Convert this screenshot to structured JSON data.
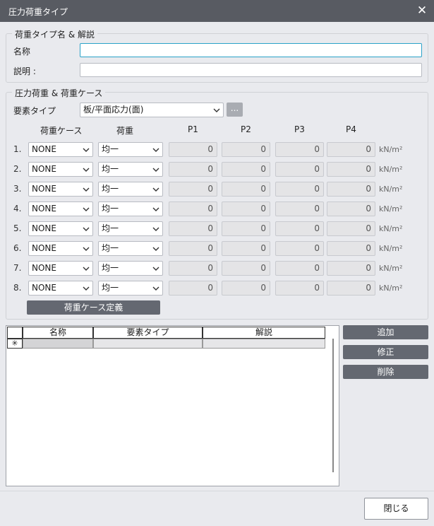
{
  "window": {
    "title": "圧力荷重タイプ",
    "close_glyph": "✕"
  },
  "name_group": {
    "legend": "荷重タイプ名 & 解説",
    "name_label": "名称",
    "name_value": "",
    "desc_label": "説明 :",
    "desc_value": ""
  },
  "load_group": {
    "legend": "圧力荷重 & 荷重ケース",
    "element_type_label": "要素タイプ",
    "element_type_value": "板/平面応力(面)",
    "browse_label": "...",
    "headers": {
      "case": "荷重ケース",
      "load": "荷重",
      "p1": "P1",
      "p2": "P2",
      "p3": "P3",
      "p4": "P4"
    },
    "rows": [
      {
        "num": "1.",
        "case": "NONE",
        "load": "均一",
        "p1": "0",
        "p2": "0",
        "p3": "0",
        "p4": "0",
        "unit": "kN/m²"
      },
      {
        "num": "2.",
        "case": "NONE",
        "load": "均一",
        "p1": "0",
        "p2": "0",
        "p3": "0",
        "p4": "0",
        "unit": "kN/m²"
      },
      {
        "num": "3.",
        "case": "NONE",
        "load": "均一",
        "p1": "0",
        "p2": "0",
        "p3": "0",
        "p4": "0",
        "unit": "kN/m²"
      },
      {
        "num": "4.",
        "case": "NONE",
        "load": "均一",
        "p1": "0",
        "p2": "0",
        "p3": "0",
        "p4": "0",
        "unit": "kN/m²"
      },
      {
        "num": "5.",
        "case": "NONE",
        "load": "均一",
        "p1": "0",
        "p2": "0",
        "p3": "0",
        "p4": "0",
        "unit": "kN/m²"
      },
      {
        "num": "6.",
        "case": "NONE",
        "load": "均一",
        "p1": "0",
        "p2": "0",
        "p3": "0",
        "p4": "0",
        "unit": "kN/m²"
      },
      {
        "num": "7.",
        "case": "NONE",
        "load": "均一",
        "p1": "0",
        "p2": "0",
        "p3": "0",
        "p4": "0",
        "unit": "kN/m²"
      },
      {
        "num": "8.",
        "case": "NONE",
        "load": "均一",
        "p1": "0",
        "p2": "0",
        "p3": "0",
        "p4": "0",
        "unit": "kN/m²"
      }
    ],
    "define_cases_label": "荷重ケース定義"
  },
  "grid": {
    "row_marker": "✳",
    "columns": [
      "名称",
      "要素タイプ",
      "解説"
    ]
  },
  "actions": {
    "add": "追加",
    "modify": "修正",
    "delete": "削除"
  },
  "footer": {
    "close": "閉じる"
  }
}
